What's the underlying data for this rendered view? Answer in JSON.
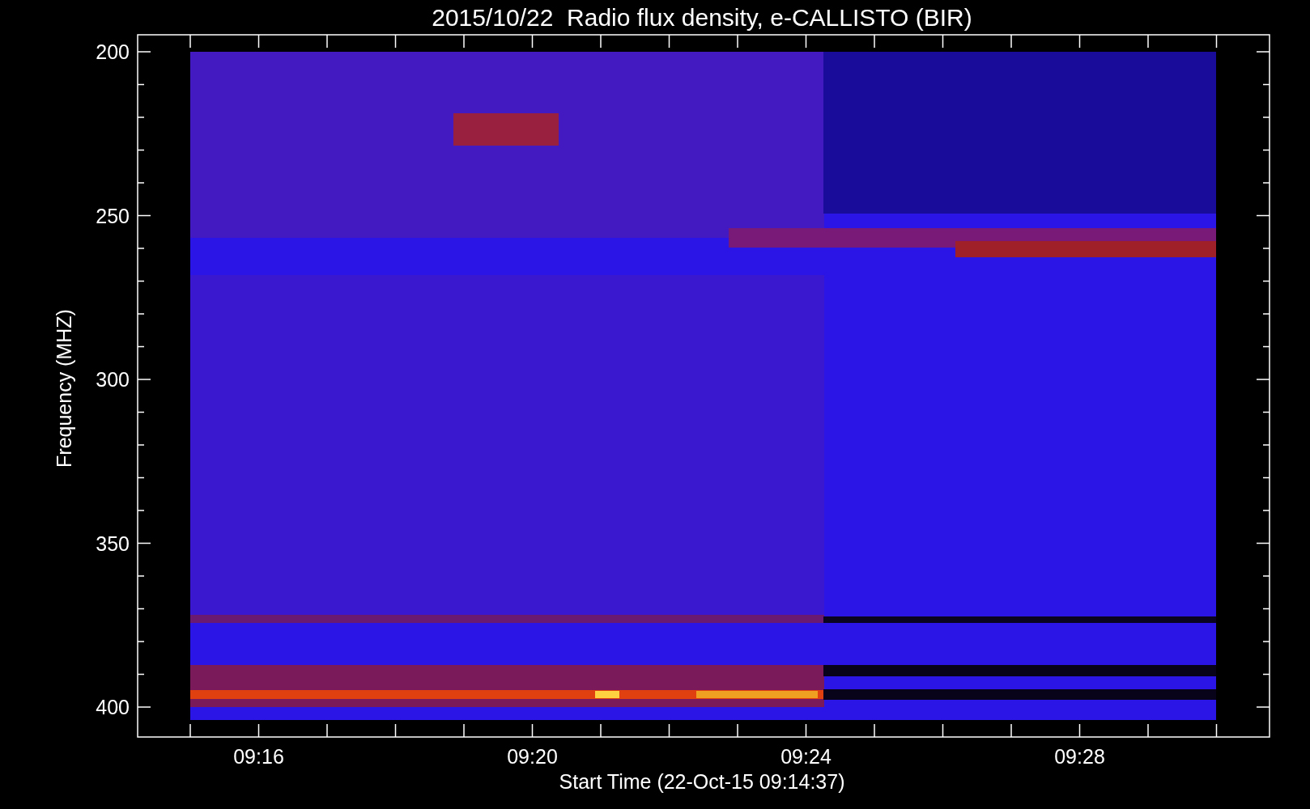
{
  "title": "2015/10/22  Radio flux density, e-CALLISTO (BIR)",
  "y_axis": {
    "label": "Frequency (MHZ)",
    "ticks": [
      "200",
      "250",
      "300",
      "350",
      "400"
    ]
  },
  "x_axis": {
    "label": "Start Time (22-Oct-15 09:14:37)",
    "ticks": [
      "09:16",
      "09:20",
      "09:24",
      "09:28"
    ]
  }
}
